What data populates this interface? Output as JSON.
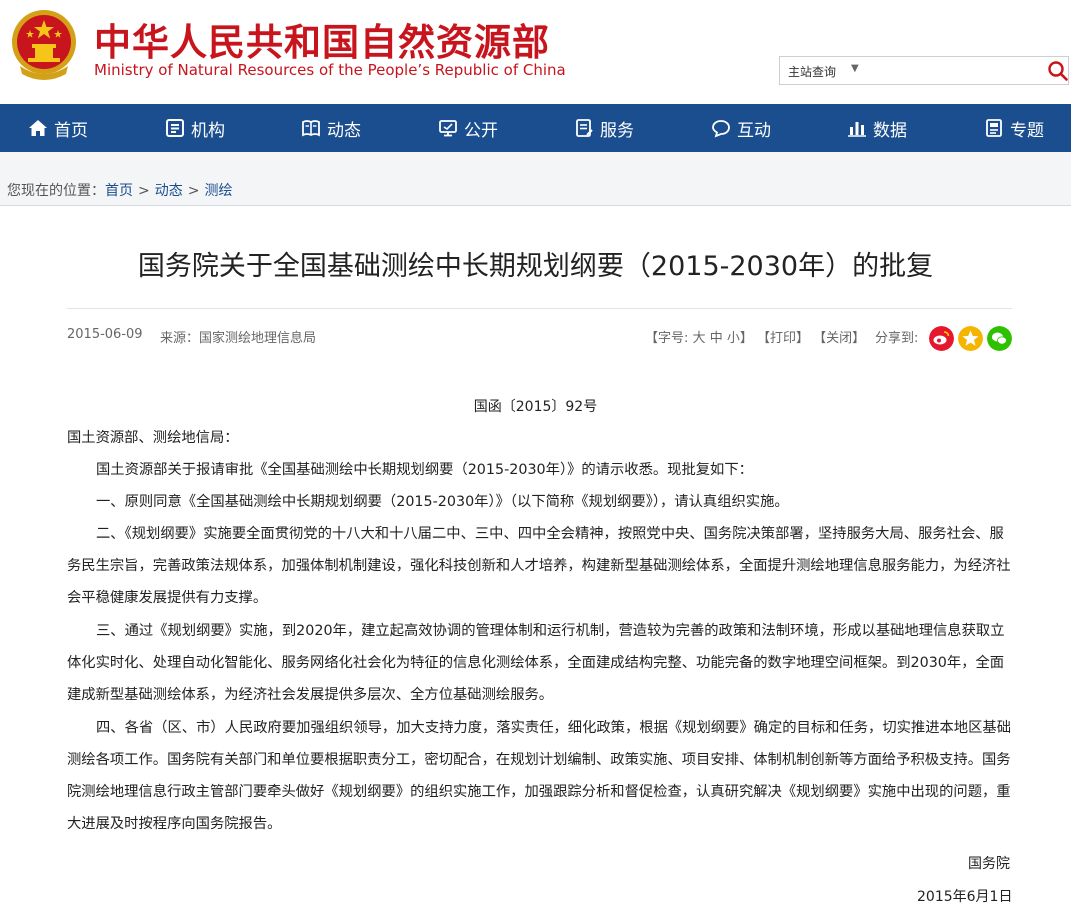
{
  "header": {
    "title_cn": "中华人民共和国自然资源部",
    "title_en": "Ministry of Natural Resources of the People’s Republic of China",
    "search_scope": "主站查询",
    "search_placeholder": ""
  },
  "nav": {
    "items": [
      {
        "label": "首页",
        "icon": "home-icon"
      },
      {
        "label": "机构",
        "icon": "organization-icon"
      },
      {
        "label": "动态",
        "icon": "news-icon"
      },
      {
        "label": "公开",
        "icon": "disclosure-icon"
      },
      {
        "label": "服务",
        "icon": "service-icon"
      },
      {
        "label": "互动",
        "icon": "chat-icon"
      },
      {
        "label": "数据",
        "icon": "bar-chart-icon"
      },
      {
        "label": "专题",
        "icon": "topic-icon"
      }
    ]
  },
  "breadcrumb": {
    "prefix": "您现在的位置：",
    "items": [
      "首页",
      "动态",
      "测绘"
    ],
    "separator": ">"
  },
  "article": {
    "title": "国务院关于全国基础测绘中长期规划纲要（2015-2030年）的批复",
    "date": "2015-06-09",
    "source_label": "来源：",
    "source": "国家测绘地理信息局",
    "font_label": "【字号:",
    "font_large": "大",
    "font_medium": "中",
    "font_small": "小",
    "font_close": "】",
    "print": "【打印】",
    "close": "【关闭】",
    "share_label": "分享到:",
    "doc_number": "国函〔2015〕92号",
    "salutation": "国土资源部、测绘地信局：",
    "paragraphs": [
      "国土资源部关于报请审批《全国基础测绘中长期规划纲要（2015-2030年）》的请示收悉。现批复如下：",
      "一、原则同意《全国基础测绘中长期规划纲要（2015-2030年）》（以下简称《规划纲要》），请认真组织实施。",
      "二、《规划纲要》实施要全面贯彻党的十八大和十八届二中、三中、四中全会精神，按照党中央、国务院决策部署，坚持服务大局、服务社会、服务民生宗旨，完善政策法规体系，加强体制机制建设，强化科技创新和人才培养，构建新型基础测绘体系，全面提升测绘地理信息服务能力，为经济社会平稳健康发展提供有力支撑。",
      "三、通过《规划纲要》实施，到2020年，建立起高效协调的管理体制和运行机制，营造较为完善的政策和法制环境，形成以基础地理信息获取立体化实时化、处理自动化智能化、服务网络化社会化为特征的信息化测绘体系，全面建成结构完整、功能完备的数字地理空间框架。到2030年，全面建成新型基础测绘体系，为经济社会发展提供多层次、全方位基础测绘服务。",
      "四、各省（区、市）人民政府要加强组织领导，加大支持力度，落实责任，细化政策，根据《规划纲要》确定的目标和任务，切实推进本地区基础测绘各项工作。国务院有关部门和单位要根据职责分工，密切配合，在规划计划编制、政策实施、项目安排、体制机制创新等方面给予积极支持。国务院测绘地理信息行政主管部门要牵头做好《规划纲要》的组织实施工作，加强跟踪分析和督促检查，认真研究解决《规划纲要》实施中出现的问题，重大进展及时按程序向国务院报告。"
    ],
    "signature_org": "国务院",
    "signature_date": "2015年6月1日"
  },
  "colors": {
    "brand_red": "#c8141c",
    "nav_blue": "#1a4e8f",
    "weibo": "#e6162d",
    "qzone": "#f5b400",
    "wechat": "#2dc100"
  }
}
